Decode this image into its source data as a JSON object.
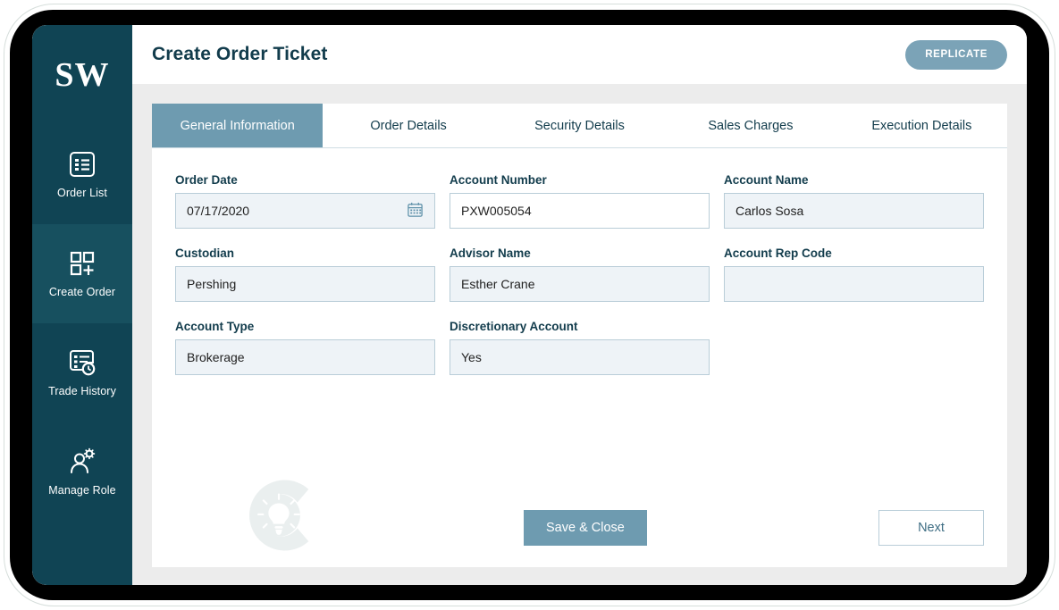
{
  "brand": {
    "logo_text": "SW",
    "primary": "#104454",
    "accent": "#6e9bb0"
  },
  "sidebar": {
    "items": [
      {
        "label": "Order List",
        "icon": "list-icon",
        "active": false
      },
      {
        "label": "Create Order",
        "icon": "grid-plus-icon",
        "active": true
      },
      {
        "label": "Trade History",
        "icon": "list-clock-icon",
        "active": false
      },
      {
        "label": "Manage Role",
        "icon": "user-gear-icon",
        "active": false
      }
    ]
  },
  "header": {
    "title": "Create Order Ticket",
    "replicate_label": "REPLICATE"
  },
  "tabs": [
    {
      "label": "General Information",
      "active": true
    },
    {
      "label": "Order Details",
      "active": false
    },
    {
      "label": "Security Details",
      "active": false
    },
    {
      "label": "Sales Charges",
      "active": false
    },
    {
      "label": "Execution Details",
      "active": false
    }
  ],
  "form": {
    "rows": [
      [
        {
          "label": "Order Date",
          "value": "07/17/2020",
          "editable": false,
          "icon": "calendar-icon"
        },
        {
          "label": "Account Number",
          "value": "PXW005054",
          "editable": true,
          "icon": null
        },
        {
          "label": "Account Name",
          "value": "Carlos Sosa",
          "editable": false,
          "icon": null
        }
      ],
      [
        {
          "label": "Custodian",
          "value": "Pershing",
          "editable": false,
          "icon": null
        },
        {
          "label": "Advisor Name",
          "value": "Esther Crane",
          "editable": false,
          "icon": null
        },
        {
          "label": "Account Rep Code",
          "value": "",
          "editable": false,
          "icon": null
        }
      ],
      [
        {
          "label": "Account Type",
          "value": "Brokerage",
          "editable": false,
          "icon": null
        },
        {
          "label": "Discretionary Account",
          "value": "Yes",
          "editable": false,
          "icon": null
        },
        {
          "label": "",
          "value": "",
          "editable": false,
          "icon": null,
          "blank": true
        }
      ]
    ]
  },
  "footer": {
    "save_label": "Save & Close",
    "next_label": "Next"
  },
  "watermark": {
    "icon": "c-lightbulb-watermark-icon"
  }
}
